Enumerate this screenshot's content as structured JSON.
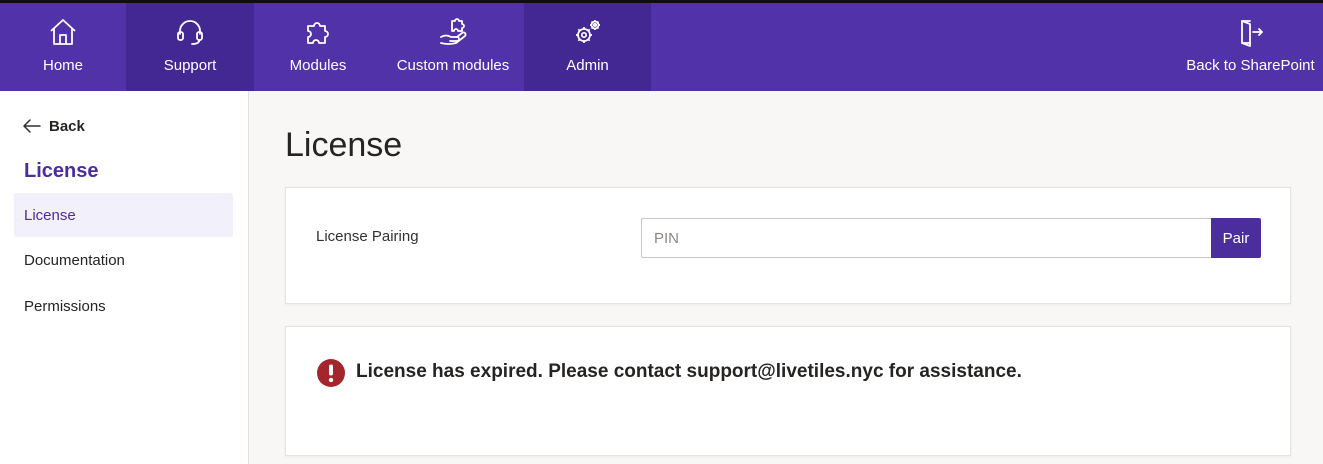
{
  "topnav": {
    "items": [
      {
        "label": "Home",
        "icon": "home-icon"
      },
      {
        "label": "Support",
        "icon": "headset-icon"
      },
      {
        "label": "Modules",
        "icon": "puzzle-icon"
      },
      {
        "label": "Custom modules",
        "icon": "hand-puzzle-icon"
      },
      {
        "label": "Admin",
        "icon": "gears-icon"
      }
    ],
    "back_to_sharepoint": {
      "label": "Back to SharePoint",
      "icon": "exit-door-icon"
    }
  },
  "sidebar": {
    "back_label": "Back",
    "title": "License",
    "items": [
      {
        "label": "License",
        "active": true
      },
      {
        "label": "Documentation",
        "active": false
      },
      {
        "label": "Permissions",
        "active": false
      }
    ]
  },
  "main": {
    "title": "License",
    "pairing": {
      "label": "License Pairing",
      "pin_placeholder": "PIN",
      "pin_value": "",
      "pair_button": "Pair"
    },
    "alert": {
      "icon": "error-exclamation-icon",
      "message": "License has expired. Please contact support@livetiles.nyc for assistance."
    }
  },
  "colors": {
    "brand": "#5132a8",
    "nav_active": "#432893",
    "accent": "#4b2d9d",
    "error": "#a4262c",
    "page_bg": "#f8f7f5"
  }
}
